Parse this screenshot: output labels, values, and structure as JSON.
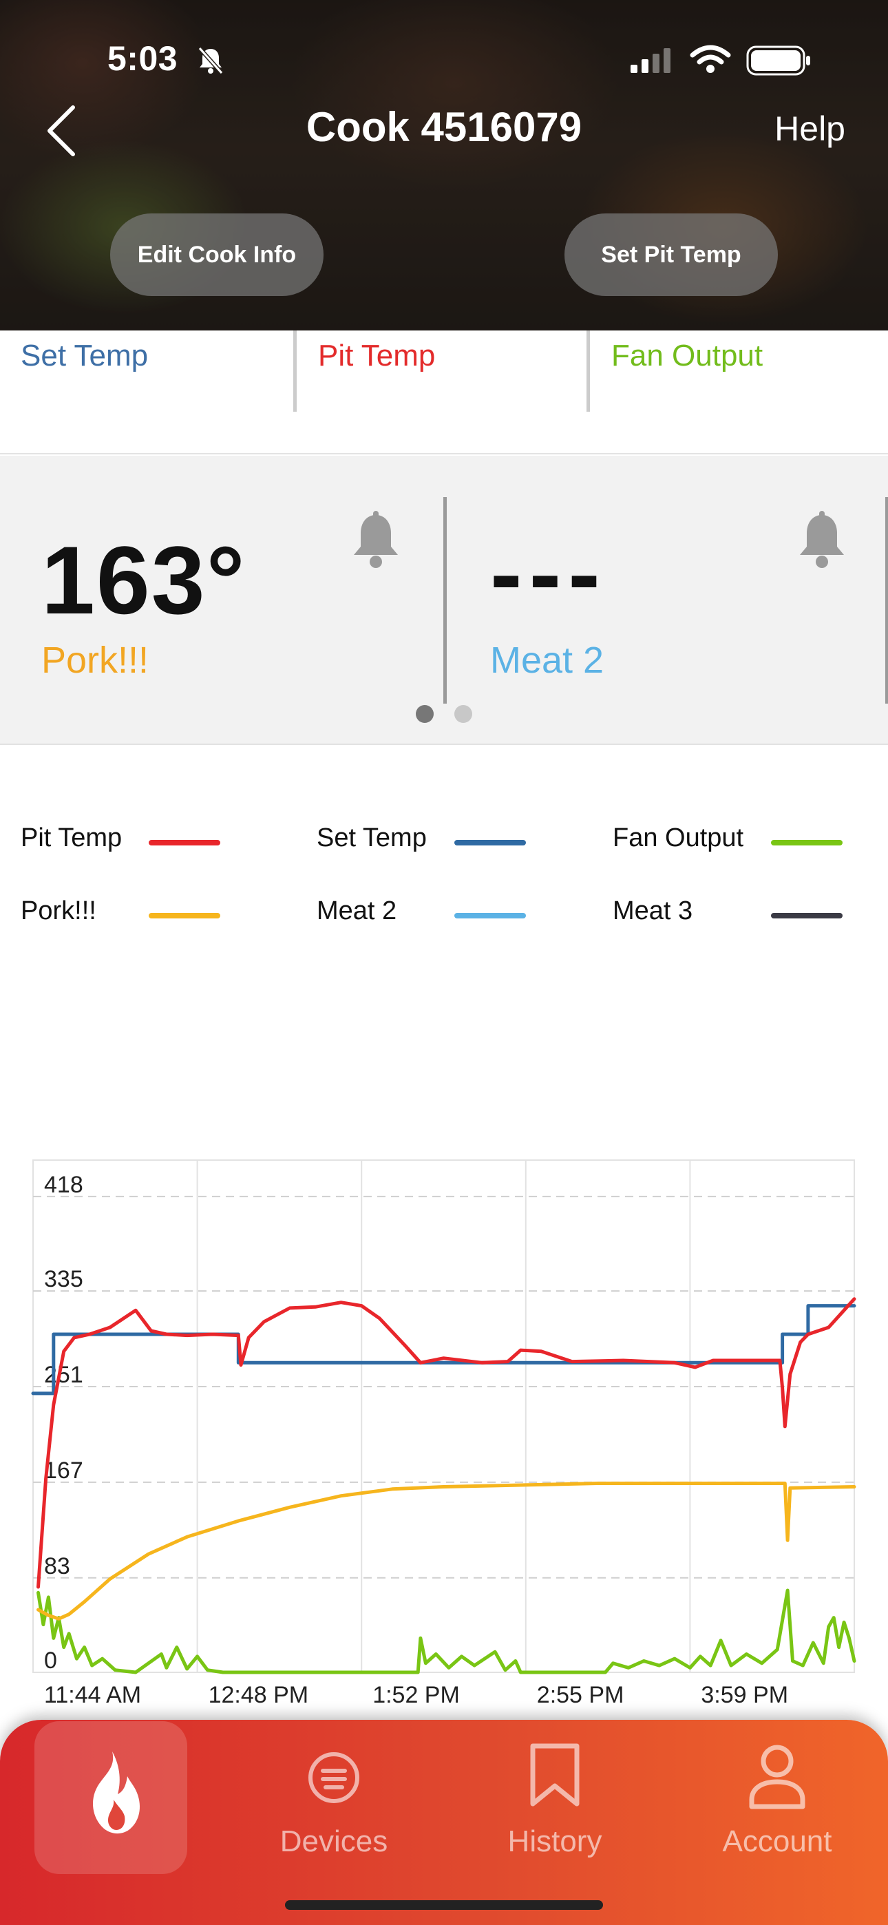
{
  "status_bar": {
    "time": "5:03"
  },
  "nav": {
    "title": "Cook 4516079",
    "help_label": "Help",
    "edit_button": "Edit Cook Info",
    "set_pit_button": "Set Pit Temp"
  },
  "stats": {
    "set_temp_label": "Set Temp",
    "pit_temp_label": "Pit Temp",
    "fan_output_label": "Fan Output"
  },
  "probes": [
    {
      "value": "163°",
      "name": "Pork!!!"
    },
    {
      "value": "---",
      "name": "Meat 2"
    }
  ],
  "legend": [
    {
      "label": "Pit Temp",
      "color": "#e8262b"
    },
    {
      "label": "Set Temp",
      "color": "#2f6aa3"
    },
    {
      "label": "Fan Output",
      "color": "#79c514"
    },
    {
      "label": "Pork!!!",
      "color": "#f6b51d"
    },
    {
      "label": "Meat 2",
      "color": "#5bb2e5"
    },
    {
      "label": "Meat 3",
      "color": "#3a3a44"
    }
  ],
  "chart_data": {
    "type": "line",
    "x_ticks": [
      "11:44 AM",
      "12:48 PM",
      "1:52 PM",
      "2:55 PM",
      "3:59 PM"
    ],
    "y_ticks": [
      418,
      335,
      251,
      167,
      83,
      0
    ],
    "ylim": [
      0,
      450
    ],
    "x_range_minutes": [
      0,
      320
    ],
    "grid": true,
    "series": [
      {
        "name": "Set Temp",
        "color": "#2f6aa3",
        "points": [
          [
            0,
            245
          ],
          [
            8,
            245
          ],
          [
            8,
            297
          ],
          [
            80,
            297
          ],
          [
            80,
            272
          ],
          [
            292,
            272
          ],
          [
            292,
            297
          ],
          [
            302,
            297
          ],
          [
            302,
            322
          ],
          [
            320,
            322
          ]
        ]
      },
      {
        "name": "Pit Temp",
        "color": "#e8262b",
        "points": [
          [
            2,
            75
          ],
          [
            5,
            170
          ],
          [
            8,
            235
          ],
          [
            12,
            282
          ],
          [
            16,
            294
          ],
          [
            22,
            297
          ],
          [
            30,
            303
          ],
          [
            40,
            318
          ],
          [
            46,
            300
          ],
          [
            52,
            297
          ],
          [
            60,
            296
          ],
          [
            70,
            297
          ],
          [
            80,
            296
          ],
          [
            81,
            270
          ],
          [
            84,
            294
          ],
          [
            90,
            308
          ],
          [
            100,
            320
          ],
          [
            110,
            321
          ],
          [
            120,
            325
          ],
          [
            128,
            322
          ],
          [
            135,
            311
          ],
          [
            145,
            287
          ],
          [
            151,
            272
          ],
          [
            160,
            276
          ],
          [
            175,
            272
          ],
          [
            185,
            273
          ],
          [
            190,
            283
          ],
          [
            198,
            282
          ],
          [
            210,
            273
          ],
          [
            230,
            274
          ],
          [
            250,
            272
          ],
          [
            258,
            268
          ],
          [
            265,
            274
          ],
          [
            285,
            274
          ],
          [
            291,
            274
          ],
          [
            292,
            250
          ],
          [
            293,
            216
          ],
          [
            295,
            262
          ],
          [
            299,
            290
          ],
          [
            302,
            297
          ],
          [
            310,
            303
          ],
          [
            320,
            328
          ]
        ]
      },
      {
        "name": "Pork!!!",
        "color": "#f6b51d",
        "points": [
          [
            2,
            55
          ],
          [
            6,
            50
          ],
          [
            10,
            47
          ],
          [
            14,
            51
          ],
          [
            20,
            62
          ],
          [
            30,
            82
          ],
          [
            45,
            104
          ],
          [
            60,
            119
          ],
          [
            80,
            133
          ],
          [
            100,
            145
          ],
          [
            120,
            155
          ],
          [
            140,
            161
          ],
          [
            160,
            163
          ],
          [
            180,
            164
          ],
          [
            200,
            165
          ],
          [
            220,
            166
          ],
          [
            240,
            166
          ],
          [
            260,
            166
          ],
          [
            280,
            166
          ],
          [
            293,
            166
          ],
          [
            294,
            116
          ],
          [
            295,
            162
          ],
          [
            320,
            163
          ]
        ]
      },
      {
        "name": "Fan Output",
        "color": "#79c514",
        "points": [
          [
            2,
            70
          ],
          [
            4,
            42
          ],
          [
            6,
            66
          ],
          [
            8,
            30
          ],
          [
            10,
            48
          ],
          [
            12,
            22
          ],
          [
            14,
            34
          ],
          [
            17,
            12
          ],
          [
            20,
            22
          ],
          [
            23,
            6
          ],
          [
            27,
            12
          ],
          [
            32,
            2
          ],
          [
            40,
            0
          ],
          [
            50,
            16
          ],
          [
            52,
            4
          ],
          [
            56,
            22
          ],
          [
            60,
            3
          ],
          [
            64,
            14
          ],
          [
            68,
            2
          ],
          [
            74,
            0
          ],
          [
            150,
            0
          ],
          [
            151,
            30
          ],
          [
            153,
            8
          ],
          [
            157,
            16
          ],
          [
            162,
            4
          ],
          [
            167,
            14
          ],
          [
            172,
            6
          ],
          [
            180,
            18
          ],
          [
            184,
            2
          ],
          [
            188,
            10
          ],
          [
            190,
            0
          ],
          [
            223,
            0
          ],
          [
            226,
            8
          ],
          [
            232,
            4
          ],
          [
            238,
            10
          ],
          [
            244,
            6
          ],
          [
            250,
            12
          ],
          [
            256,
            4
          ],
          [
            260,
            14
          ],
          [
            264,
            6
          ],
          [
            268,
            28
          ],
          [
            272,
            6
          ],
          [
            278,
            16
          ],
          [
            284,
            8
          ],
          [
            290,
            20
          ],
          [
            294,
            72
          ],
          [
            296,
            10
          ],
          [
            300,
            6
          ],
          [
            304,
            26
          ],
          [
            308,
            8
          ],
          [
            310,
            40
          ],
          [
            312,
            48
          ],
          [
            314,
            22
          ],
          [
            316,
            44
          ],
          [
            318,
            30
          ],
          [
            320,
            10
          ]
        ]
      },
      {
        "name": "Meat 2",
        "color": "#5bb2e5",
        "points": []
      },
      {
        "name": "Meat 3",
        "color": "#3a3a44",
        "points": []
      }
    ]
  },
  "tabs": {
    "devices": "Devices",
    "history": "History",
    "account": "Account"
  }
}
